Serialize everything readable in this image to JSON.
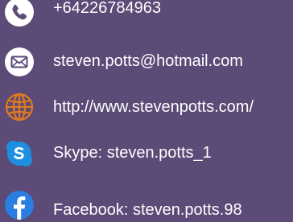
{
  "contacts": {
    "phone": {
      "text": "+64226784963",
      "icon": "phone-icon",
      "icon_bg": "#ffffff",
      "icon_fg": "#5c4a77"
    },
    "email": {
      "text": "steven.potts@hotmail.com",
      "icon": "envelope-icon",
      "icon_bg": "#ffffff",
      "icon_fg": "#5c4a77"
    },
    "website": {
      "text": "http://www.stevenpotts.com/",
      "icon": "globe-icon",
      "icon_color": "#e07a1f"
    },
    "skype": {
      "text": "Skype: steven.potts_1",
      "icon": "skype-icon",
      "icon_bg": "#1e8fe1",
      "icon_fg": "#ffffff"
    },
    "facebook": {
      "text": "Facebook: steven.potts.98",
      "icon": "facebook-icon",
      "icon_bg": "#2a7de1",
      "icon_fg": "#ffffff"
    }
  },
  "colors": {
    "background": "#5c4a77",
    "text": "#ffffff"
  }
}
